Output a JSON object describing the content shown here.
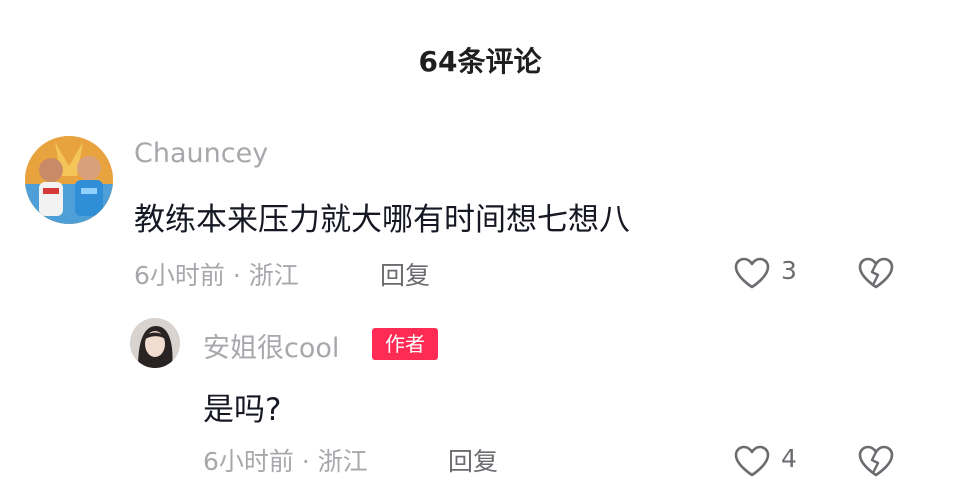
{
  "header": {
    "title": "64条评论"
  },
  "comments": [
    {
      "username": "Chauncey",
      "text": "教练本来压力就大哪有时间想七想八",
      "meta": "6小时前 · 浙江",
      "reply_label": "回复",
      "likes": "3",
      "avatar_icon": "user-avatar",
      "like_icon": "heart-icon",
      "dislike_icon": "broken-heart-icon"
    },
    {
      "username": "安姐很cool",
      "badge": "作者",
      "text": "是吗?",
      "meta": "6小时前 · 浙江",
      "reply_label": "回复",
      "likes": "4",
      "avatar_icon": "user-avatar",
      "like_icon": "heart-icon",
      "dislike_icon": "broken-heart-icon"
    }
  ],
  "colors": {
    "author_badge": "#fe2c55",
    "secondary_text": "#a7a8ac",
    "primary_text": "#161823"
  }
}
